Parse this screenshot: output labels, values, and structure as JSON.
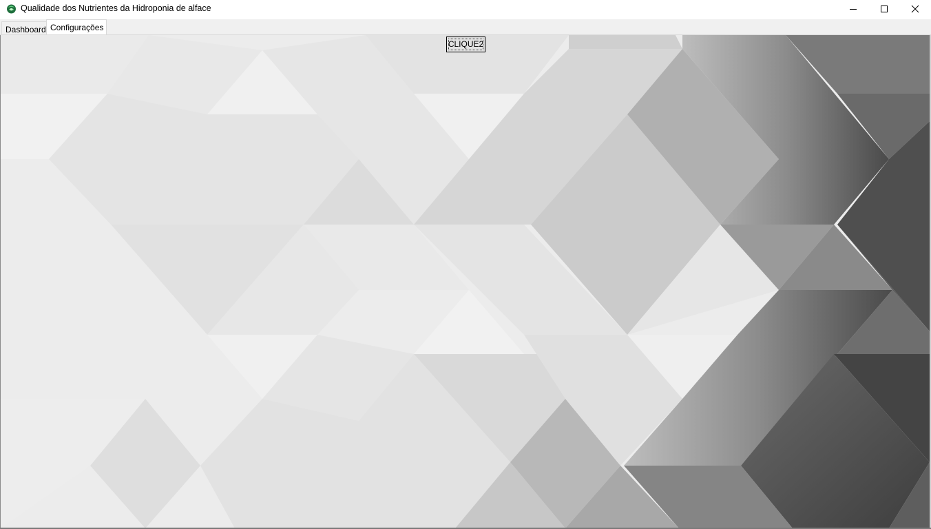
{
  "window": {
    "title": "Qualidade dos Nutrientes da Hidroponia de alface",
    "app_icon": "lettuce-icon",
    "controls": {
      "minimize_icon": "minimize-icon",
      "maximize_icon": "maximize-icon",
      "close_icon": "close-icon"
    }
  },
  "tabs": [
    {
      "label": "Dashboard",
      "selected": false
    },
    {
      "label": "Configurações",
      "selected": true
    }
  ],
  "content": {
    "button_label": "CLIQUE2",
    "background": "grey-geometric-pattern"
  },
  "colors": {
    "title_bar": "#ffffff",
    "tab_strip": "#f0f0f0",
    "button_face": "#e1e1e1",
    "icon_green": "#2e8b57"
  }
}
